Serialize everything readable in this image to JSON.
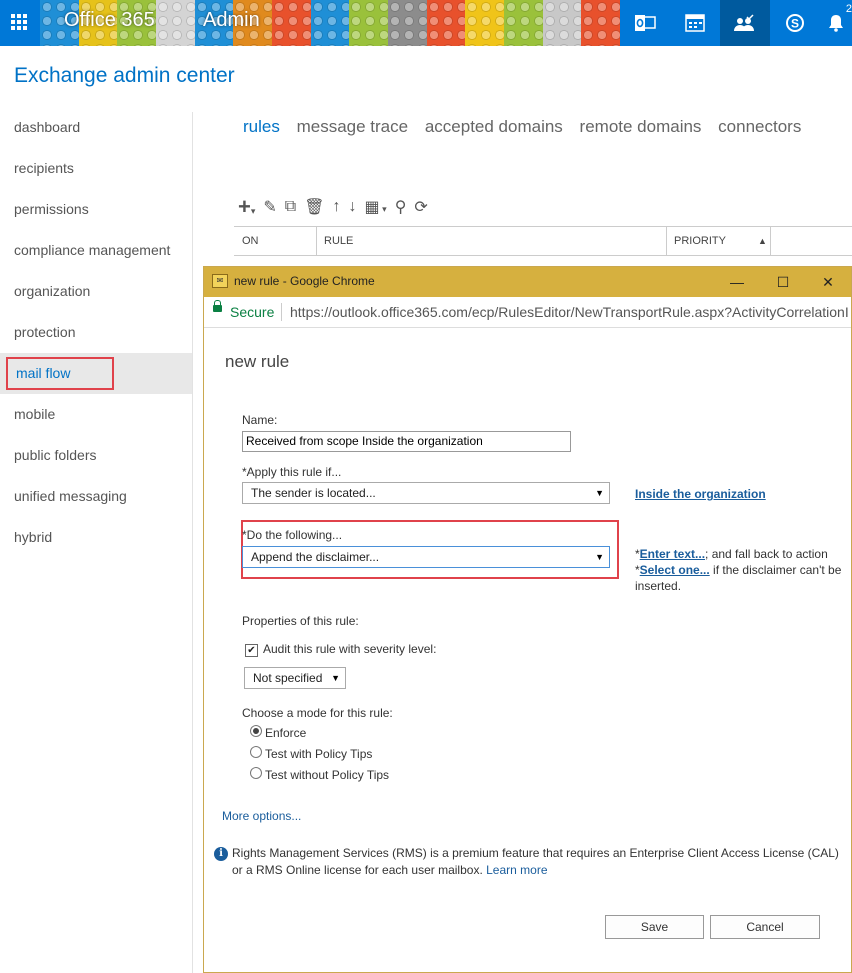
{
  "topbar": {
    "brand": "Office 365",
    "section": "Admin",
    "icons": [
      "waffle-icon",
      "outlook-icon",
      "calendar-icon",
      "people-icon",
      "skype-icon",
      "bell-icon"
    ],
    "notification_count": "2",
    "colors": {
      "blue": "#0078d7",
      "dark_blue": "#005a9e"
    }
  },
  "eac": {
    "title": "Exchange admin center"
  },
  "sidebar": {
    "items": [
      {
        "label": "dashboard"
      },
      {
        "label": "recipients"
      },
      {
        "label": "permissions"
      },
      {
        "label": "compliance management"
      },
      {
        "label": "organization"
      },
      {
        "label": "protection"
      },
      {
        "label": "mail flow"
      },
      {
        "label": "mobile"
      },
      {
        "label": "public folders"
      },
      {
        "label": "unified messaging"
      },
      {
        "label": "hybrid"
      }
    ],
    "active": "mail flow"
  },
  "tabs": [
    "rules",
    "message trace",
    "accepted domains",
    "remote domains",
    "connectors"
  ],
  "table": {
    "columns": [
      "ON",
      "RULE",
      "PRIORITY"
    ]
  },
  "dialog": {
    "window_title": "new rule - Google Chrome",
    "secure_label": "Secure",
    "url": "https://outlook.office365.com/ecp/RulesEditor/NewTransportRule.aspx?ActivityCorrelationI",
    "heading": "new rule",
    "name_label": "Name:",
    "name_value": "Received from scope Inside the organization",
    "apply_label": "*Apply this rule if...",
    "apply_value": "The sender is located...",
    "apply_link": "Inside the organization",
    "do_label": "*Do the following...",
    "do_value": "Append the disclaimer...",
    "do_side": {
      "star1": "*",
      "link1": "Enter text...",
      "text1": "and fall back to action",
      "star2": "*",
      "link2": "Select one...",
      "text2": "if the disclaimer can't be inserted."
    },
    "properties_label": "Properties of this rule:",
    "audit_label": "Audit this rule with severity level:",
    "audit_checked": true,
    "severity_value": "Not specified",
    "mode_label": "Choose a mode for this rule:",
    "modes": [
      "Enforce",
      "Test with Policy Tips",
      "Test without Policy Tips"
    ],
    "mode_selected": "Enforce",
    "more_options": "More options...",
    "info_text": "Rights Management Services (RMS) is a premium feature that requires an Enterprise Client Access License (CAL) or a RMS Online license for each user mailbox.",
    "learn_more": "Learn more",
    "save_label": "Save",
    "cancel_label": "Cancel",
    "chrome_color": "#d6b03f"
  }
}
